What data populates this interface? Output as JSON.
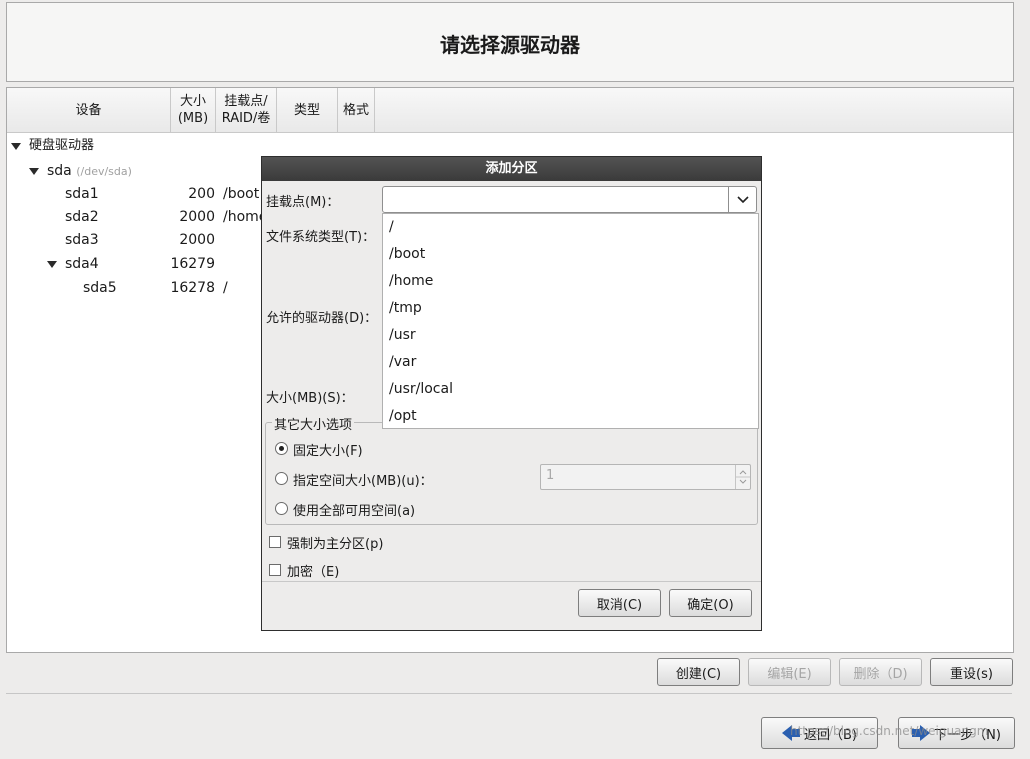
{
  "header": {
    "title": "请选择源驱动器"
  },
  "tree": {
    "columns": {
      "device": "设备",
      "size_line1": "大小",
      "size_line2": "(MB)",
      "mount_line1": "挂载点/",
      "mount_line2": "RAID/卷",
      "type": "类型",
      "format": "格式"
    },
    "root_label": "硬盘驱动器",
    "disk": {
      "name": "sda",
      "path": "(/dev/sda)"
    },
    "partitions": [
      {
        "name": "sda1",
        "size": "200",
        "mount": "/boot"
      },
      {
        "name": "sda2",
        "size": "2000",
        "mount": "/home"
      },
      {
        "name": "sda3",
        "size": "2000",
        "mount": ""
      },
      {
        "name": "sda4",
        "size": "16279",
        "mount": ""
      },
      {
        "name": "sda5",
        "size": "16278",
        "mount": "/"
      }
    ]
  },
  "dialog": {
    "title": "添加分区",
    "mount_label": "挂载点(M)：",
    "fstype_label": "文件系统类型(T)：",
    "drives_label": "允许的驱动器(D)：",
    "size_label": "大小(MB)(S)：",
    "mount_value": "",
    "mount_options": [
      "/",
      "/boot",
      "/home",
      "/tmp",
      "/usr",
      "/var",
      "/usr/local",
      "/opt"
    ],
    "other_size_legend": "其它大小选项",
    "radio_fixed": "固定大小(F)",
    "radio_fill_to": "指定空间大小(MB)(u)：",
    "radio_fill_all": "使用全部可用空间(a)",
    "fill_to_value": "1",
    "force_primary": "强制为主分区(p)",
    "encrypt": "加密（E)",
    "cancel_button": "取消(C)",
    "ok_button": "确定(O)"
  },
  "actions": {
    "create": "创建(C)",
    "edit": "编辑(E)",
    "delete": "删除（D)",
    "reset": "重设(s)"
  },
  "nav": {
    "back": "返回（B)",
    "next": "下一步（N)"
  },
  "watermark": "https://blog.csdn.net/weiguangm"
}
